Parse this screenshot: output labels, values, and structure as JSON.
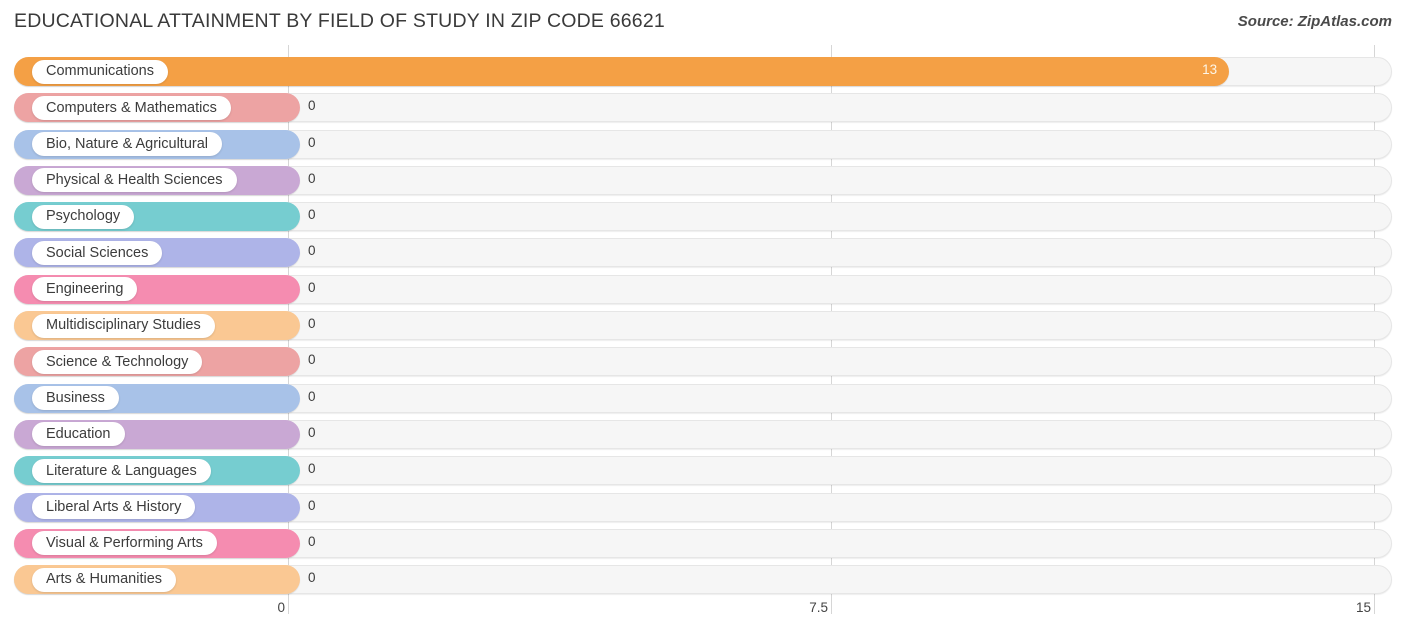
{
  "header": {
    "title": "EDUCATIONAL ATTAINMENT BY FIELD OF STUDY IN ZIP CODE 66621",
    "source": "Source: ZipAtlas.com"
  },
  "chart_data": {
    "type": "bar",
    "orientation": "horizontal",
    "title": "EDUCATIONAL ATTAINMENT BY FIELD OF STUDY IN ZIP CODE 66621",
    "xlabel": "",
    "ylabel": "",
    "xlim": [
      0,
      15
    ],
    "xticks": [
      0,
      7.5,
      15
    ],
    "xtick_labels": [
      "0",
      "7.5",
      "15"
    ],
    "grid": true,
    "legend": "none",
    "categories": [
      "Communications",
      "Computers & Mathematics",
      "Bio, Nature & Agricultural",
      "Physical & Health Sciences",
      "Psychology",
      "Social Sciences",
      "Engineering",
      "Multidisciplinary Studies",
      "Science & Technology",
      "Business",
      "Education",
      "Literature & Languages",
      "Liberal Arts & History",
      "Visual & Performing Arts",
      "Arts & Humanities"
    ],
    "values": [
      13,
      0,
      0,
      0,
      0,
      0,
      0,
      0,
      0,
      0,
      0,
      0,
      0,
      0,
      0
    ],
    "value_labels": [
      "13",
      "0",
      "0",
      "0",
      "0",
      "0",
      "0",
      "0",
      "0",
      "0",
      "0",
      "0",
      "0",
      "0",
      "0"
    ],
    "colors": [
      "#f5a košice"
    ]
  },
  "rows": [
    {
      "label": "Communications",
      "value": 13,
      "value_label": "13",
      "color": "#f5a css"
    }
  ],
  "bars": [
    {
      "label": "Communications",
      "value_label": "13",
      "color": "#f4a045",
      "min_width": 286
    },
    {
      "label": "Computers & Mathematics",
      "value_label": "0",
      "color": "#eda3a3",
      "min_width": 286
    },
    {
      "label": "Bio, Nature & Agricultural",
      "value_label": "0",
      "color": "#a8c2e8",
      "min_width": 286
    },
    {
      "label": "Physical & Health Sciences",
      "value_label": "0",
      "color": "#c9a8d4",
      "min_width": 286
    },
    {
      "label": "Psychology",
      "value_label": "0",
      "color": "#76cdd0",
      "min_width": 286
    },
    {
      "label": "Social Sciences",
      "value_label": "0",
      "color": "#aeb4e8",
      "min_width": 286
    },
    {
      "label": "Engineering",
      "value_label": "0",
      "color": "#f58cb0",
      "min_width": 286
    },
    {
      "label": "Multidisciplinary Studies",
      "value_label": "0",
      "color": "#fac893",
      "min_width": 286
    },
    {
      "label": "Science & Technology",
      "value_label": "0",
      "color": "#eda3a3",
      "min_width": 286
    },
    {
      "label": "Business",
      "value_label": "0",
      "color": "#a8c2e8",
      "min_width": 286
    },
    {
      "label": "Education",
      "value_label": "0",
      "color": "#c9a8d4",
      "min_width": 286
    },
    {
      "label": "Literature & Languages",
      "value_label": "0",
      "color": "#76cdd0",
      "min_width": 286
    },
    {
      "label": "Liberal Arts & History",
      "value_label": "0",
      "color": "#aeb4e8",
      "min_width": 286
    },
    {
      "label": "Visual & Performing Arts",
      "value_label": "0",
      "color": "#f58cb0",
      "min_width": 286
    },
    {
      "label": "Arts & Humanities",
      "value_label": "0",
      "color": "#fac893",
      "min_width": 286
    }
  ],
  "axis": {
    "ticks": [
      "0",
      "7.5",
      "15"
    ]
  },
  "colors": {
    "track": "#f6f6f6",
    "track_border": "#e6e6e6",
    "gridline": "#d6d6d6",
    "text": "#3c3c3c",
    "inside_value_text": "#fdf6e8"
  }
}
